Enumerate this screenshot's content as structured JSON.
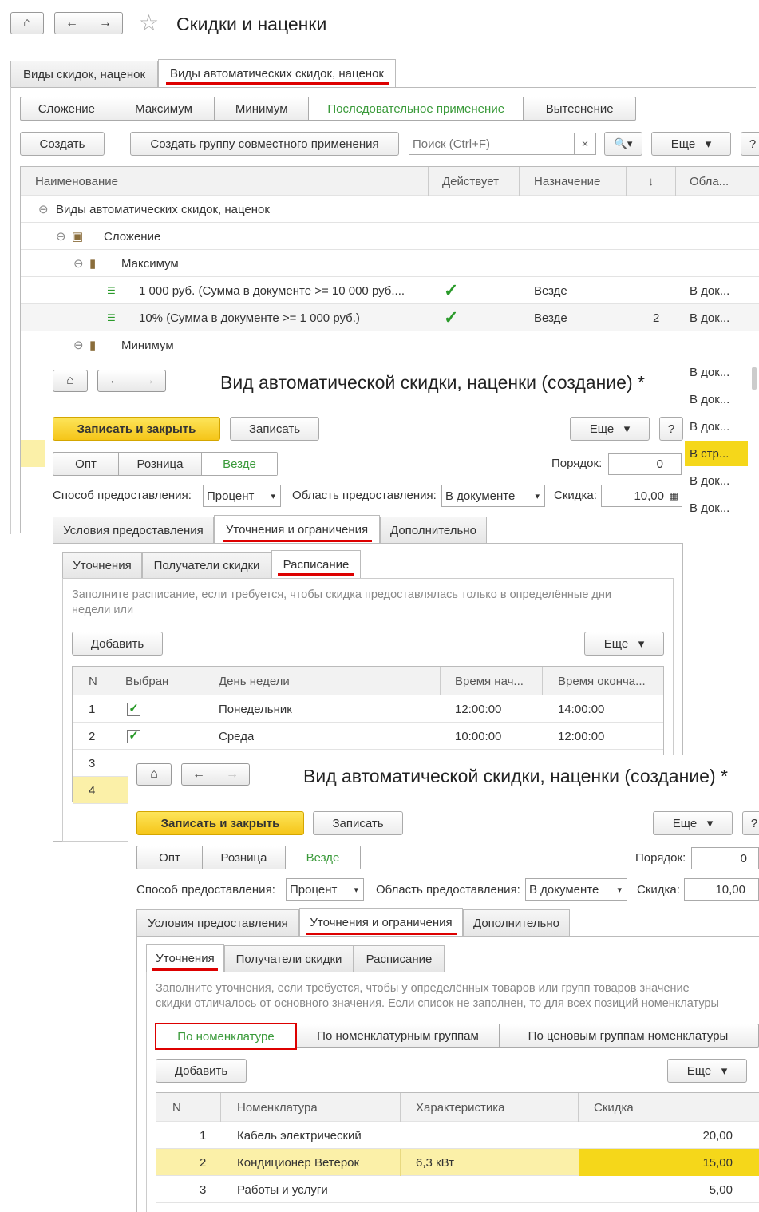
{
  "main": {
    "title": "Скидки и наценки",
    "tabs": [
      "Виды скидок, наценок",
      "Виды автоматических скидок, наценок"
    ],
    "filters": [
      "Сложение",
      "Максимум",
      "Минимум",
      "Последовательное применение",
      "Вытеснение"
    ],
    "toolbar": {
      "create": "Создать",
      "create_group": "Создать группу совместного применения",
      "search_placeholder": "Поиск (Ctrl+F)",
      "clear": "×",
      "search_btn": "🔍▾",
      "more": "Еще",
      "help": "?"
    },
    "columns": [
      "Наименование",
      "Действует",
      "Назначение",
      "↓",
      "Обла..."
    ],
    "rows": [
      {
        "name": "Виды автоматических скидок, наценок",
        "active": "",
        "purpose": "",
        "order": "",
        "area": ""
      },
      {
        "name": "Сложение",
        "active": "",
        "purpose": "",
        "order": "",
        "area": ""
      },
      {
        "name": "Максимум",
        "active": "",
        "purpose": "",
        "order": "",
        "area": ""
      },
      {
        "name": "1 000 руб. (Сумма в документе >= 10 000 руб....",
        "active": "✓",
        "purpose": "Везде",
        "order": "",
        "area": "В док..."
      },
      {
        "name": "10% (Сумма в документе >= 1 000 руб.)",
        "active": "✓",
        "purpose": "Везде",
        "order": "2",
        "area": "В док..."
      },
      {
        "name": "Минимум",
        "active": "",
        "purpose": "",
        "order": "",
        "area": ""
      }
    ],
    "side_area": [
      "В док...",
      "В док...",
      "В док...",
      "В стр...",
      "В док...",
      "В док..."
    ]
  },
  "form1": {
    "title": "Вид автоматической скидки, наценки (создание) *",
    "save_close": "Записать и закрыть",
    "save": "Записать",
    "more": "Еще",
    "help": "?",
    "purpose": [
      "Опт",
      "Розница",
      "Везде"
    ],
    "order_label": "Порядок:",
    "order_value": "0",
    "method_label": "Способ предоставления:",
    "method_value": "Процент",
    "area_label": "Область предоставления:",
    "area_value": "В документе",
    "discount_label": "Скидка:",
    "discount_value": "10,00",
    "tabs": [
      "Условия предоставления",
      "Уточнения и ограничения",
      "Дополнительно"
    ],
    "subtabs": [
      "Уточнения",
      "Получатели скидки",
      "Расписание"
    ],
    "hint": "Заполните расписание, если требуется, чтобы скидка предоставлялась только в определённые дни недели или",
    "add": "Добавить",
    "columns": [
      "N",
      "Выбран",
      "День недели",
      "Время нач...",
      "Время оконча..."
    ],
    "rows": [
      {
        "n": "1",
        "checked": "✓",
        "day": "Понедельник",
        "start": "12:00:00",
        "end": "14:00:00"
      },
      {
        "n": "2",
        "checked": "✓",
        "day": "Среда",
        "start": "10:00:00",
        "end": "12:00:00"
      },
      {
        "n": "3",
        "checked": "",
        "day": "",
        "start": "",
        "end": ""
      },
      {
        "n": "4",
        "checked": "",
        "day": "",
        "start": "",
        "end": ""
      }
    ]
  },
  "form2": {
    "title": "Вид автоматической скидки, наценки (создание) *",
    "save_close": "Записать и закрыть",
    "save": "Записать",
    "more": "Еще",
    "help": "?",
    "purpose": [
      "Опт",
      "Розница",
      "Везде"
    ],
    "order_label": "Порядок:",
    "order_value": "0",
    "method_label": "Способ предоставления:",
    "method_value": "Процент",
    "area_label": "Область предоставления:",
    "area_value": "В документе",
    "discount_label": "Скидка:",
    "discount_value": "10,00",
    "tabs": [
      "Условия предоставления",
      "Уточнения и ограничения",
      "Дополнительно"
    ],
    "subtabs": [
      "Уточнения",
      "Получатели скидки",
      "Расписание"
    ],
    "hint1": "Заполните уточнения, если требуется, чтобы у определённых товаров или групп товаров значение",
    "hint2": "скидки отличалось от основного значения. Если список не заполнен, то для всех позиций номенклатуры",
    "modes": [
      "По номенклатуре",
      "По номенклатурным группам",
      "По ценовым группам номенклатуры"
    ],
    "add": "Добавить",
    "columns": [
      "N",
      "Номенклатура",
      "Характеристика",
      "Скидка"
    ],
    "rows": [
      {
        "n": "1",
        "item": "Кабель электрический",
        "char": "",
        "discount": "20,00"
      },
      {
        "n": "2",
        "item": "Кондиционер Ветерок",
        "char": "6,3 кВт",
        "discount": "15,00"
      },
      {
        "n": "3",
        "item": "Работы и услуги",
        "char": "",
        "discount": "5,00"
      }
    ]
  }
}
